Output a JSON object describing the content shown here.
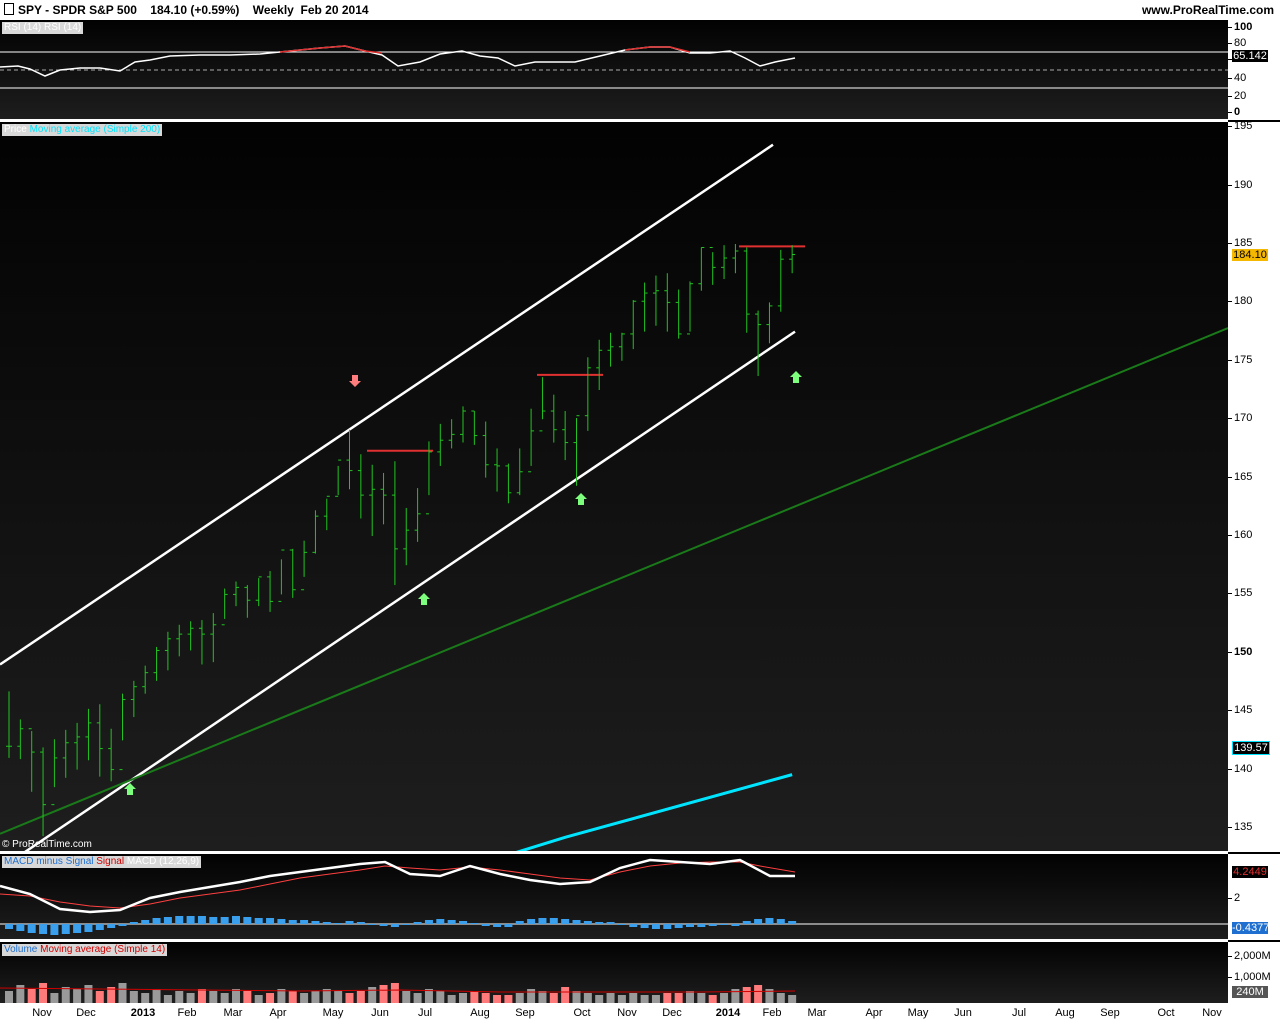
{
  "header": {
    "symbol": "SPY - SPDR S&P 500",
    "last": "184.10 (+0.59%)",
    "period": "Weekly",
    "date": "Feb 20 2014",
    "logo": "www.ProRealTime.com"
  },
  "panels": {
    "rsi": {
      "tag1": "RSI (14)",
      "tag2": "RSI (14)",
      "value": "65.142",
      "ticks": [
        "100",
        "80",
        "60",
        "40",
        "20",
        "0"
      ]
    },
    "price": {
      "tag1": "Price",
      "tag2": "Moving average (Simple 200)",
      "last": "184.10",
      "ma_value": "139.57",
      "watermark": "© ProRealTime.com",
      "ticks": [
        "195",
        "190",
        "185",
        "180",
        "175",
        "170",
        "165",
        "160",
        "155",
        "150",
        "145",
        "140",
        "135"
      ]
    },
    "macd": {
      "tag1": "MACD minus Signal",
      "tag2": "Signal",
      "tag3": "MACD (12,26,9)",
      "macd_value": "4.2449",
      "hist_value": "-0.4377",
      "ticks": [
        "2"
      ]
    },
    "volume": {
      "tag1": "Volume",
      "tag2": "Moving average (Simple 14)",
      "value": "240M",
      "ticks": [
        "2,000M",
        "1,000M"
      ]
    }
  },
  "x_labels": [
    "Nov",
    "Dec",
    "2013",
    "Feb",
    "Mar",
    "Apr",
    "May",
    "Jun",
    "Jul",
    "Aug",
    "Sep",
    "Oct",
    "Nov",
    "Dec",
    "2014",
    "Feb",
    "Mar",
    "Apr",
    "May",
    "Jun",
    "Jul",
    "Aug",
    "Sep",
    "Oct",
    "Nov"
  ],
  "colors": {
    "bull": "#22c322",
    "bear": "#e03030",
    "ma": "#00e5ff",
    "trend": "#1a7a1a",
    "hist": "#3aa0ee"
  },
  "chart_data": {
    "type": "ohlc",
    "title": "SPY - SPDR S&P 500 Weekly",
    "x": [
      "2012-10-26",
      "2012-11-02",
      "2012-11-09",
      "2012-11-16",
      "2012-11-23",
      "2012-11-30",
      "2012-12-07",
      "2012-12-14",
      "2012-12-21",
      "2012-12-28",
      "2013-01-04",
      "2013-01-11",
      "2013-01-18",
      "2013-01-25",
      "2013-02-01",
      "2013-02-08",
      "2013-02-15",
      "2013-02-22",
      "2013-03-01",
      "2013-03-08",
      "2013-03-15",
      "2013-03-22",
      "2013-03-29",
      "2013-04-05",
      "2013-04-12",
      "2013-04-19",
      "2013-04-26",
      "2013-05-03",
      "2013-05-10",
      "2013-05-17",
      "2013-05-24",
      "2013-05-31",
      "2013-06-07",
      "2013-06-14",
      "2013-06-21",
      "2013-06-28",
      "2013-07-05",
      "2013-07-12",
      "2013-07-19",
      "2013-07-26",
      "2013-08-02",
      "2013-08-09",
      "2013-08-16",
      "2013-08-23",
      "2013-08-30",
      "2013-09-06",
      "2013-09-13",
      "2013-09-20",
      "2013-09-27",
      "2013-10-04",
      "2013-10-11",
      "2013-10-18",
      "2013-10-25",
      "2013-11-01",
      "2013-11-08",
      "2013-11-15",
      "2013-11-22",
      "2013-11-29",
      "2013-12-06",
      "2013-12-13",
      "2013-12-20",
      "2013-12-27",
      "2014-01-03",
      "2014-01-10",
      "2014-01-17",
      "2014-01-24",
      "2014-01-31",
      "2014-02-07",
      "2014-02-14",
      "2014-02-21"
    ],
    "high": [
      146.7,
      144.3,
      143.3,
      141.9,
      142.6,
      143.4,
      144.0,
      145.2,
      145.6,
      143.5,
      146.5,
      147.6,
      148.9,
      150.5,
      151.8,
      152.4,
      152.7,
      152.8,
      153.4,
      155.5,
      156.1,
      155.8,
      156.4,
      157.0,
      158.0,
      158.9,
      159.6,
      162.2,
      163.2,
      166.0,
      169.1,
      167.0,
      166.1,
      165.4,
      166.4,
      162.4,
      164.1,
      168.1,
      169.6,
      170.0,
      171.1,
      170.7,
      169.8,
      167.5,
      166.2,
      167.5,
      170.9,
      173.6,
      172.1,
      170.7,
      170.1,
      175.3,
      176.8,
      177.4,
      177.4,
      180.2,
      181.7,
      182.3,
      182.5,
      181.1,
      181.8,
      184.7,
      184.3,
      184.9,
      185.0,
      184.7,
      179.3,
      180.0,
      184.5,
      184.9
    ],
    "low": [
      141.0,
      140.9,
      138.1,
      134.3,
      138.5,
      139.3,
      140.0,
      140.8,
      139.4,
      139.0,
      142.5,
      144.5,
      146.5,
      147.6,
      148.5,
      149.7,
      150.2,
      149.0,
      149.2,
      152.9,
      154.0,
      153.0,
      154.0,
      153.5,
      155.0,
      154.7,
      156.5,
      158.5,
      160.5,
      163.5,
      164.0,
      161.5,
      160.0,
      161.0,
      155.8,
      157.5,
      159.5,
      163.5,
      166.0,
      167.5,
      168.0,
      167.8,
      165.0,
      163.8,
      162.8,
      163.5,
      166.0,
      170.0,
      168.0,
      166.5,
      164.3,
      169.0,
      172.5,
      174.5,
      175.0,
      176.0,
      177.5,
      178.0,
      177.5,
      176.9,
      177.5,
      181.0,
      181.5,
      182.0,
      182.5,
      177.4,
      173.7,
      176.5,
      179.2,
      182.5
    ],
    "close": [
      142.0,
      143.5,
      141.5,
      137.0,
      141.0,
      142.3,
      142.8,
      144.0,
      141.8,
      140.0,
      146.0,
      147.1,
      148.3,
      150.2,
      151.2,
      151.6,
      152.1,
      151.6,
      152.4,
      155.0,
      155.6,
      154.5,
      156.5,
      154.4,
      158.8,
      155.4,
      158.6,
      161.7,
      163.4,
      166.5,
      165.6,
      163.5,
      164.0,
      163.5,
      158.9,
      160.5,
      161.9,
      167.2,
      168.2,
      168.7,
      170.7,
      168.6,
      166.1,
      166.0,
      163.7,
      165.5,
      169.0,
      170.7,
      169.1,
      168.0,
      170.3,
      174.4,
      175.9,
      176.2,
      177.3,
      180.1,
      180.8,
      181.0,
      180.0,
      177.3,
      181.6,
      184.7,
      183.0,
      183.8,
      184.4,
      179.0,
      178.1,
      179.7,
      183.7,
      184.1
    ],
    "ma200": {
      "name": "Moving average (Simple 200)",
      "x": [
        "2013-07-12",
        "2013-10-04",
        "2014-02-21"
      ],
      "values": [
        130.6,
        134.2,
        139.57
      ]
    },
    "rsi": {
      "name": "RSI (14)",
      "last": 65.142
    },
    "macd": {
      "name": "MACD (12,26,9)",
      "last": 4.2449,
      "histogram_last": -0.4377
    },
    "resistance_levels": [
      167.3,
      173.8,
      184.8
    ],
    "ylim": [
      130,
      197
    ],
    "grid": false,
    "legend": "top-left"
  }
}
